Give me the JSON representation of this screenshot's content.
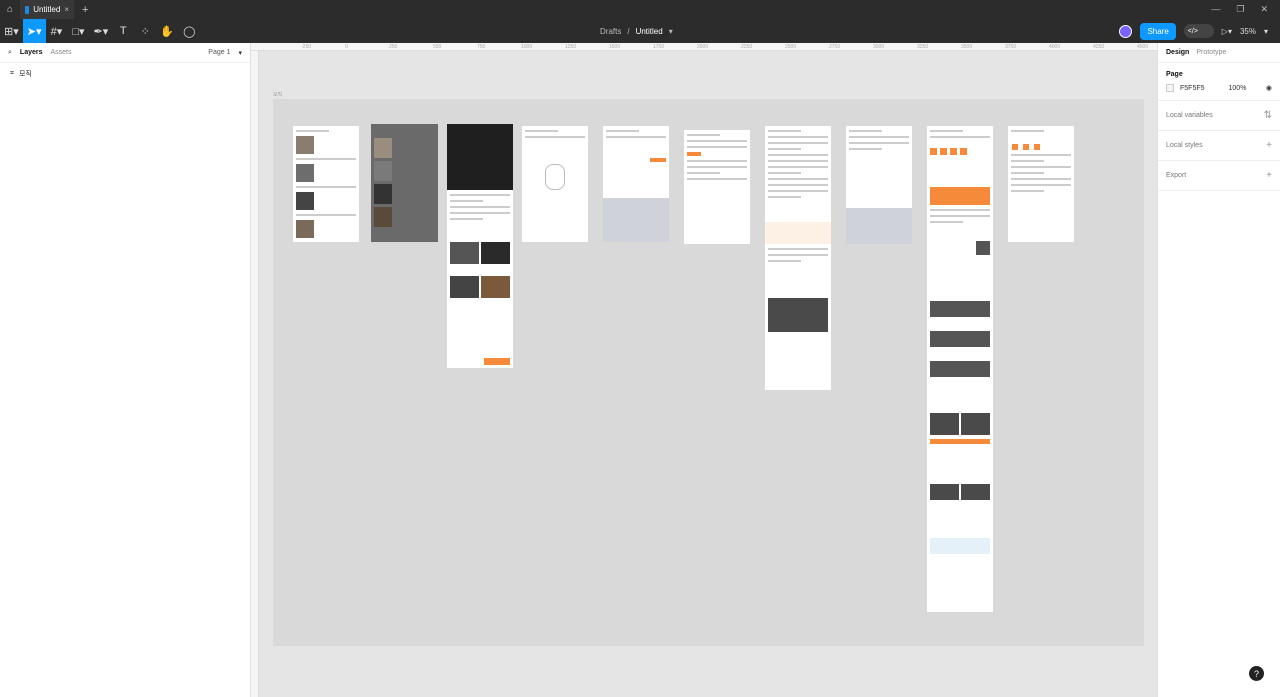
{
  "tabbar": {
    "home_icon": "home-icon",
    "tab_title": "Untitled",
    "tab_close": "×",
    "add_tab": "+"
  },
  "toolbar": {
    "breadcrumb_drafts": "Drafts",
    "breadcrumb_sep": "/",
    "file_name": "Untitled",
    "share_label": "Share",
    "zoom": "35%"
  },
  "left_panel": {
    "tab_layers": "Layers",
    "tab_assets": "Assets",
    "page_selector": "Page 1",
    "layers": [
      {
        "name": "모직"
      }
    ]
  },
  "right_panel": {
    "tab_design": "Design",
    "tab_prototype": "Prototype",
    "page_section_title": "Page",
    "page_color": "F5F5F5",
    "page_opacity": "100%",
    "local_variables": "Local variables",
    "local_styles": "Local styles",
    "export": "Export"
  },
  "canvas": {
    "section_label": "모직",
    "section_color": "#d9d9d9",
    "accent": "#f58a3b",
    "ruler_marks": [
      "-250",
      "0",
      "250",
      "500",
      "750",
      "1000",
      "1250",
      "1500",
      "1750",
      "2000",
      "2250",
      "2500",
      "2750",
      "3000",
      "3250",
      "3500",
      "3750",
      "4000",
      "4250",
      "4500"
    ]
  },
  "help": "?"
}
